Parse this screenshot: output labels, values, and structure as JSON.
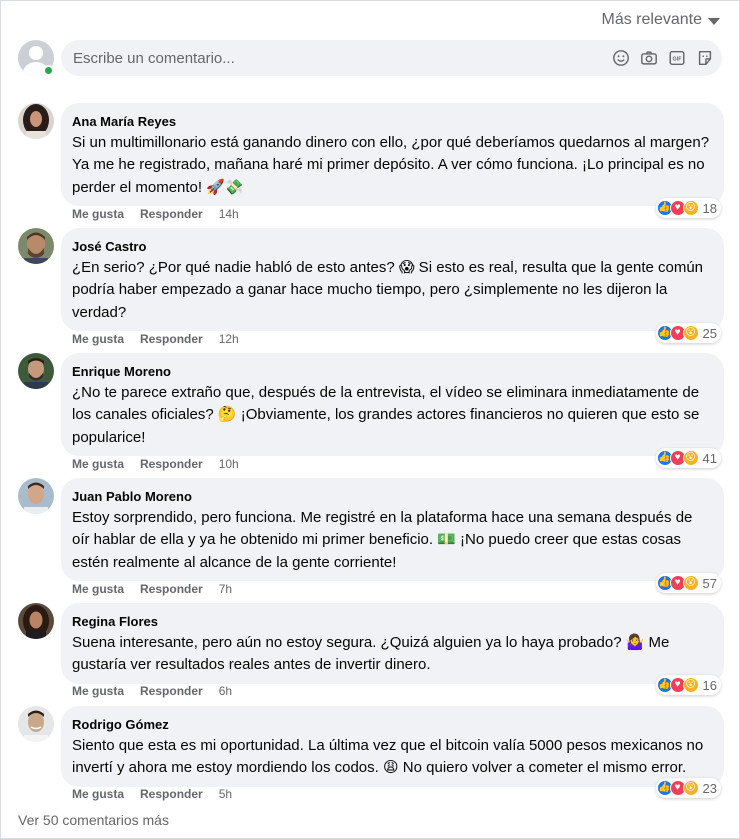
{
  "header": {
    "sort_label": "Más relevante"
  },
  "composer": {
    "placeholder": "Escribe un comentario..."
  },
  "actions": {
    "like": "Me gusta",
    "reply": "Responder"
  },
  "comments": [
    {
      "author": "Ana María Reyes",
      "text": "Si un multimillonario está ganando dinero con ello, ¿por qué deberíamos quedarnos al margen? Ya me he registrado, mañana haré mi primer depósito. A ver cómo funciona. ¡Lo principal es no perder el momento! 🚀💸",
      "time": "14h",
      "reactions": "18",
      "avatar_color": "#3b2a26"
    },
    {
      "author": "José Castro",
      "text": "¿En serio? ¿Por qué nadie habló de esto antes? 😱 Si esto es real, resulta que la gente común podría haber empezado a ganar hace mucho tiempo, pero ¿simplemente no les dijeron la verdad?",
      "time": "12h",
      "reactions": "25",
      "avatar_color": "#6b5a47"
    },
    {
      "author": "Enrique Moreno",
      "text": "¿No te parece extraño que, después de la entrevista, el vídeo se eliminara inmediatamente de los canales oficiales? 🤔 ¡Obviamente, los grandes actores financieros no quieren que esto se popularice!",
      "time": "10h",
      "reactions": "41",
      "avatar_color": "#3f5a3a"
    },
    {
      "author": "Juan Pablo Moreno",
      "text": "Estoy sorprendido, pero funciona. Me registré en la plataforma hace una semana después de oír hablar de ella y ya he obtenido mi primer beneficio. 💵 ¡No puedo creer que estas cosas estén realmente al alcance de la gente corriente!",
      "time": "7h",
      "reactions": "57",
      "avatar_color": "#8aa3b8"
    },
    {
      "author": "Regina Flores",
      "text": "Suena interesante, pero aún no estoy segura. ¿Quizá alguien ya lo haya probado? 🤷‍♀️ Me gustaría ver resultados reales antes de invertir dinero.",
      "time": "6h",
      "reactions": "16",
      "avatar_color": "#4a3426"
    },
    {
      "author": "Rodrigo Gómez",
      "text": "Siento que esta es mi oportunidad. La última vez que el bitcoin valía 5000 pesos mexicanos no invertí y ahora me estoy mordiendo los codos. 😩 No quiero volver a cometer el mismo error.",
      "time": "5h",
      "reactions": "23",
      "avatar_color": "#c9a88a"
    }
  ],
  "footer": {
    "more_comments": "Ver 50 comentarios más"
  },
  "colors": {
    "bubble": "#f0f2f5",
    "like": "#1877f2",
    "love": "#f33e58",
    "wow": "#f7b125",
    "online": "#31a24c"
  }
}
